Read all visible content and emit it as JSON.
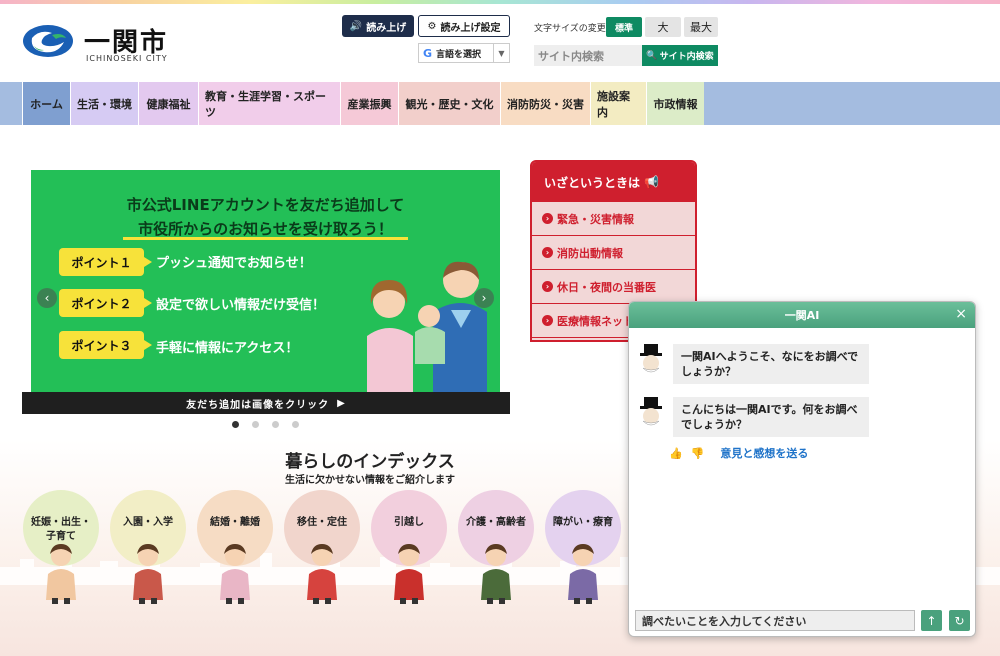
{
  "header": {
    "logo_jp": "一関市",
    "logo_en": "ICHINOSEKI CITY",
    "read_aloud": "読み上げ",
    "read_settings": "読み上げ設定",
    "language": "言語を選択",
    "font_size_label": "文字サイズの変更",
    "font_standard": "標準",
    "font_large": "大",
    "font_xlarge": "最大",
    "search_placeholder": "サイト内検索",
    "search_button": "サイト内検索"
  },
  "nav": [
    {
      "label": "ホーム",
      "color": "#a4bce0"
    },
    {
      "label": "生活・環境",
      "color": "#d6cbf3"
    },
    {
      "label": "健康福祉",
      "color": "#e3c9ef"
    },
    {
      "label": "教育・生涯学習・スポーツ",
      "color": "#f1cdea"
    },
    {
      "label": "産業振興",
      "color": "#f5c9d7"
    },
    {
      "label": "観光・歴史・文化",
      "color": "#f2cfcb"
    },
    {
      "label": "消防防災・災害",
      "color": "#f8dcc3"
    },
    {
      "label": "施設案内",
      "color": "#f3ecc2"
    },
    {
      "label": "市政情報",
      "color": "#dcecc8"
    }
  ],
  "banner": {
    "title1": "市公式LINEアカウントを友だち追加して",
    "title2": "市役所からのお知らせを受け取ろう！",
    "points": [
      {
        "badge": "ポイント１",
        "text": "プッシュ通知でお知らせ！"
      },
      {
        "badge": "ポイント２",
        "text": "設定で欲しい情報だけ受信！"
      },
      {
        "badge": "ポイント３",
        "text": "手軽に情報にアクセス！"
      }
    ],
    "caption": "友だち追加は画像をクリック",
    "caption_arrow": "▶",
    "prev": "‹",
    "next": "›"
  },
  "emergency": {
    "title": "いざというときは",
    "items": [
      "緊急・災害情報",
      "消防出動情報",
      "休日・夜間の当番医",
      "医療情報ネット"
    ]
  },
  "index": {
    "title": "暮らしのインデックス",
    "subtitle": "生活に欠かせない情報をご紹介します",
    "categories": [
      {
        "line1": "妊娠・出生・",
        "line2": "子育て",
        "color": "#e6efc6"
      },
      {
        "line1": "入園・入学",
        "line2": "",
        "color": "#f2eec6"
      },
      {
        "line1": "結婚・離婚",
        "line2": "",
        "color": "#f6dcc4"
      },
      {
        "line1": "移住・定住",
        "line2": "",
        "color": "#f1d5cc"
      },
      {
        "line1": "引越し",
        "line2": "",
        "color": "#f2cfdd"
      },
      {
        "line1": "介護・高齢者",
        "line2": "",
        "color": "#eed0e3"
      },
      {
        "line1": "障がい・療育",
        "line2": "",
        "color": "#e4d2ef"
      }
    ]
  },
  "chat": {
    "title": "一関AI",
    "close": "×",
    "messages": [
      "一関AIへようこそ、なにをお調べでしょうか？",
      "こんにちは一関AIです。何をお調べでしょうか？"
    ],
    "feedback_link": "意見と感想を送る",
    "input_placeholder": "調べたいことを入力してください",
    "send": "↑",
    "reset": "↻"
  }
}
